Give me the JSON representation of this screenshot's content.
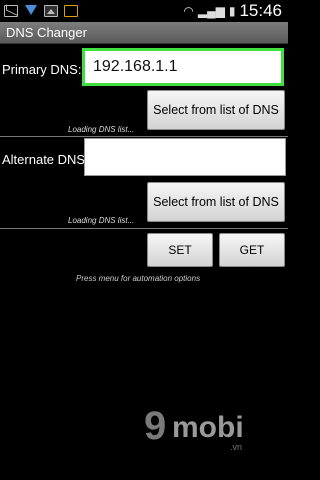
{
  "status_bar": {
    "time": "15:46",
    "icons": [
      "mail-icon",
      "download-icon",
      "image-icon",
      "tools-icon",
      "wifi-icon",
      "signal-icon",
      "battery-icon"
    ]
  },
  "app": {
    "title": "DNS Changer"
  },
  "primary": {
    "label": "Primary DNS:",
    "value": "192.168.1.1",
    "select_button": "Select from list of DNS",
    "loading": "Loading DNS list..."
  },
  "alternate": {
    "label": "Alternate DNS:",
    "value": "",
    "select_button": "Select from list of DNS",
    "loading": "Loading DNS list..."
  },
  "actions": {
    "set": "SET",
    "get": "GET"
  },
  "hint": "Press menu for automation options",
  "watermark": {
    "brand": "mobi",
    "prefix": "9",
    "suffix": ".vn"
  },
  "colors": {
    "focus_border": "#3fe03f",
    "background": "#000000",
    "titlebar": "#6b6b6b"
  }
}
